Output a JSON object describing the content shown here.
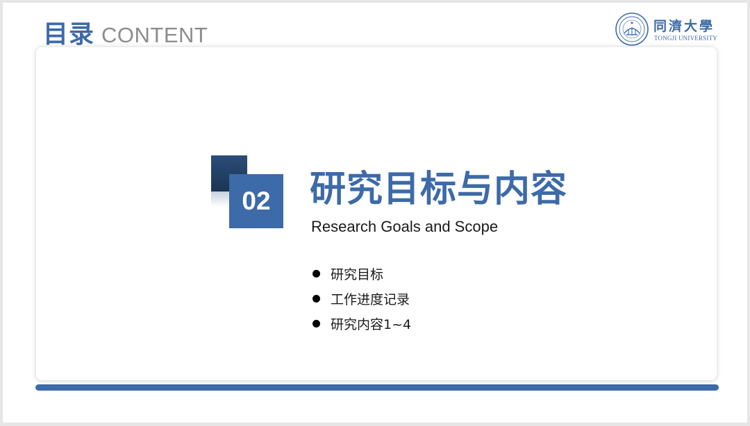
{
  "header": {
    "title_cn": "目录",
    "title_en": "CONTENT"
  },
  "logo": {
    "name_cn": "同濟大學",
    "name_en": "TONGJI UNIVERSITY"
  },
  "section": {
    "number": "02",
    "title": "研究目标与内容",
    "subtitle": "Research Goals and Scope",
    "items": [
      {
        "label": "研究目标"
      },
      {
        "label": "工作进度记录"
      },
      {
        "label": "研究内容1~4"
      }
    ]
  },
  "colors": {
    "accent": "#3d6aa8",
    "accent_dark": "#1b3453",
    "header_en": "#8c8c8c",
    "text": "#1a1a1a"
  },
  "icons": {
    "bullet": "filled-circle",
    "seal": "university-seal"
  }
}
